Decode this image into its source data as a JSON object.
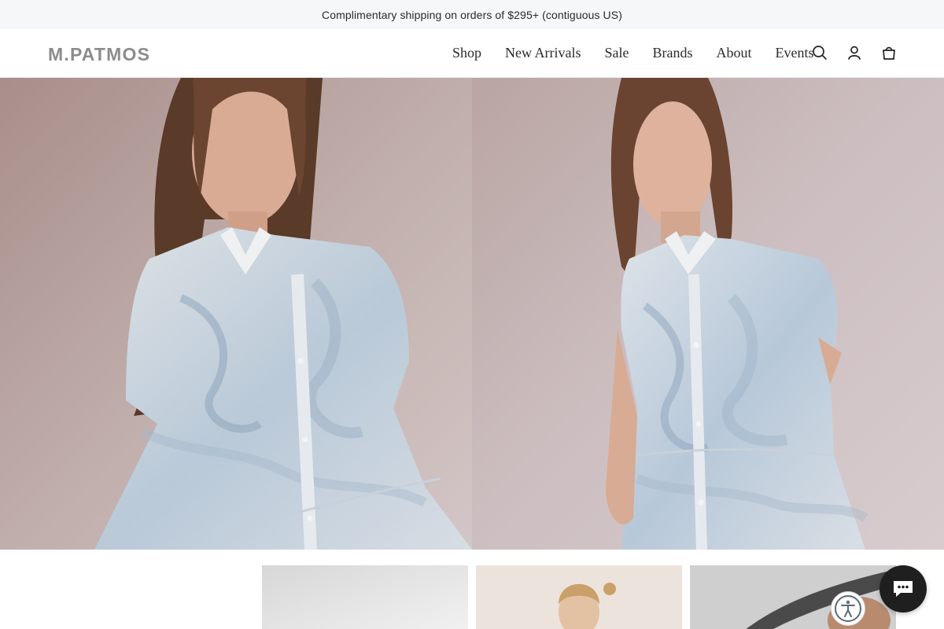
{
  "announcement": {
    "text": "Complimentary shipping on orders of $295+ (contiguous US)"
  },
  "header": {
    "logo": "M.PATMOS",
    "nav": [
      {
        "label": "Shop"
      },
      {
        "label": "New Arrivals"
      },
      {
        "label": "Sale"
      },
      {
        "label": "Brands"
      },
      {
        "label": "About"
      },
      {
        "label": "Events"
      }
    ],
    "icons": [
      "search-icon",
      "account-icon",
      "cart-icon"
    ]
  },
  "hero": {
    "images": [
      "model-left-photo",
      "model-right-photo"
    ]
  },
  "thumbnails": [
    "thumbnail-1",
    "thumbnail-2",
    "thumbnail-3"
  ],
  "widgets": [
    "accessibility-icon",
    "chat-icon"
  ],
  "colors": {
    "announcement_bg": "#f6f7f9",
    "logo": "#8c8c8c",
    "nav_text": "#2b2b2b",
    "chat_button": "#1f1f1f",
    "backdrop": "#c9b6b3",
    "dress_blue": "#b7c8d9"
  }
}
